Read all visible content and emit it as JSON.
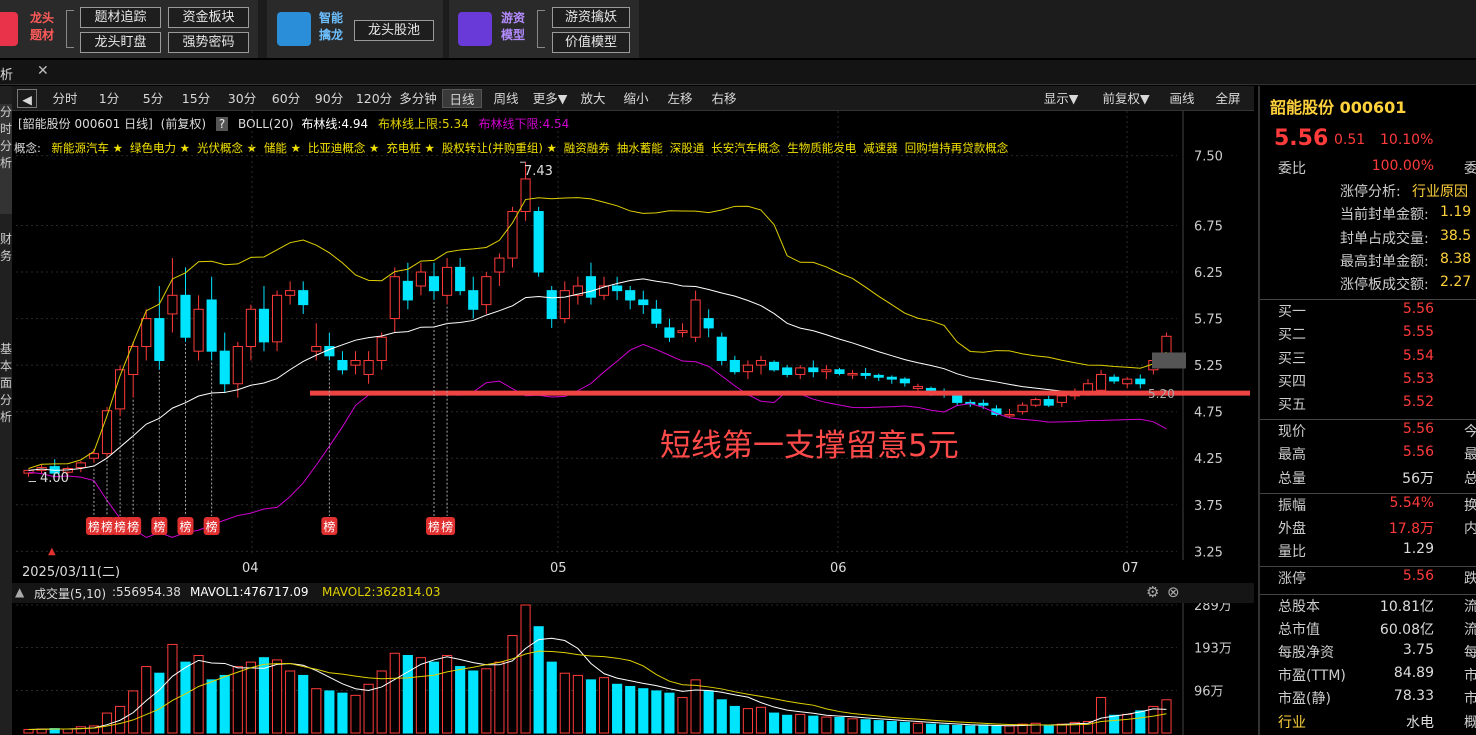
{
  "toolbar": {
    "group1": {
      "title_line1": "龙头",
      "title_line2": "题材",
      "buttons": [
        "题材追踪",
        "资金板块",
        "龙头盯盘",
        "强势密码"
      ]
    },
    "group2": {
      "title_line1": "智能",
      "title_line2": "擒龙",
      "buttons": [
        "龙头股池"
      ]
    },
    "group3": {
      "title_line1": "游资",
      "title_line2": "模型",
      "buttons": [
        "游资擒妖",
        "价值模型"
      ]
    }
  },
  "tab": {
    "label": "析",
    "close": "✕"
  },
  "side_tabs": [
    "分时分析",
    "财务",
    "基本面分析"
  ],
  "periods": [
    "分时",
    "1分",
    "5分",
    "15分",
    "30分",
    "60分",
    "90分",
    "120分",
    "多分钟",
    "日线",
    "周线",
    "更多▼",
    "放大",
    "缩小",
    "左移",
    "右移"
  ],
  "active_period": "日线",
  "right_buttons": [
    "显示▼",
    "前复权▼",
    "画线",
    "全屏"
  ],
  "chart_header": {
    "stock": "[韶能股份 000601 日线]",
    "adjust": "(前复权)",
    "help": "?",
    "boll": "BOLL(20)",
    "mid": "布林线:4.94",
    "upper": "布林线上限:5.34",
    "lower": "布林线下限:4.54"
  },
  "concepts": {
    "label": "概念:",
    "items": [
      "新能源汽车 ★",
      "绿色电力 ★",
      "光伏概念 ★",
      "储能 ★",
      "比亚迪概念 ★",
      "充电桩 ★",
      "股权转让(并购重组) ★",
      "融资融券",
      "抽水蓄能",
      "深股通",
      "长安汽车概念",
      "生物质能发电",
      "减速器",
      "回购增持再贷款概念"
    ]
  },
  "annotation": "短线第一支撑留意5元",
  "price_labels": {
    "high": "7.43",
    "low": "4.00",
    "last": "5.20"
  },
  "bang_label": "榜",
  "dates": [
    "2025/03/11(二)",
    "04",
    "05",
    "06",
    "07"
  ],
  "volume_header": {
    "title": "成交量(5,10)",
    "vol": ":556954.38",
    "mavol1": "MAVOL1:476717.09",
    "mavol2": "MAVOL2:362814.03"
  },
  "colors": {
    "up": "#ff3b3b",
    "down": "#00e5ff",
    "upper": "#e0d000",
    "mid": "#ffffff",
    "lower": "#d000d0",
    "support": "#ee4444"
  },
  "chart_data": {
    "type": "candlestick",
    "y_axis_ticks": [
      "7.50",
      "6.75",
      "6.25",
      "5.75",
      "5.25",
      "4.75",
      "4.25",
      "3.75",
      "3.25"
    ],
    "ylim": [
      3.2,
      7.55
    ],
    "support_level": 4.95,
    "candles": [
      [
        4.09,
        4.13,
        4.05,
        4.12
      ],
      [
        4.12,
        4.18,
        4.08,
        4.15
      ],
      [
        4.16,
        4.24,
        4.05,
        4.09
      ],
      [
        4.1,
        4.16,
        4.06,
        4.14
      ],
      [
        4.15,
        4.22,
        4.1,
        4.2
      ],
      [
        4.25,
        4.35,
        4.2,
        4.3
      ],
      [
        4.3,
        4.8,
        4.25,
        4.76
      ],
      [
        4.78,
        5.25,
        4.7,
        5.2
      ],
      [
        5.15,
        5.5,
        4.9,
        5.45
      ],
      [
        5.45,
        5.85,
        5.3,
        5.75
      ],
      [
        5.75,
        6.1,
        5.2,
        5.3
      ],
      [
        5.8,
        6.4,
        5.6,
        6.0
      ],
      [
        6.0,
        6.3,
        5.5,
        5.55
      ],
      [
        5.4,
        6.0,
        5.3,
        5.85
      ],
      [
        5.95,
        6.2,
        5.3,
        5.4
      ],
      [
        5.4,
        5.6,
        4.95,
        5.05
      ],
      [
        5.05,
        5.5,
        4.9,
        5.45
      ],
      [
        5.45,
        5.9,
        5.3,
        5.85
      ],
      [
        5.85,
        6.1,
        5.4,
        5.5
      ],
      [
        5.5,
        6.05,
        5.4,
        6.0
      ],
      [
        6.0,
        6.15,
        5.9,
        6.05
      ],
      [
        6.05,
        6.15,
        5.8,
        5.9
      ],
      [
        5.4,
        5.7,
        5.3,
        5.45
      ],
      [
        5.45,
        5.6,
        5.3,
        5.35
      ],
      [
        5.3,
        5.4,
        5.15,
        5.2
      ],
      [
        5.25,
        5.4,
        5.15,
        5.3
      ],
      [
        5.15,
        5.4,
        5.05,
        5.3
      ],
      [
        5.3,
        5.6,
        5.2,
        5.55
      ],
      [
        5.75,
        6.3,
        5.6,
        6.2
      ],
      [
        6.15,
        6.35,
        5.85,
        5.95
      ],
      [
        6.1,
        6.35,
        6.0,
        6.25
      ],
      [
        6.2,
        6.35,
        5.95,
        6.05
      ],
      [
        6.0,
        6.4,
        5.9,
        6.3
      ],
      [
        6.3,
        6.4,
        6.0,
        6.05
      ],
      [
        6.05,
        6.2,
        5.75,
        5.85
      ],
      [
        5.9,
        6.25,
        5.8,
        6.2
      ],
      [
        6.25,
        6.45,
        6.1,
        6.4
      ],
      [
        6.4,
        6.95,
        6.3,
        6.9
      ],
      [
        6.9,
        7.43,
        6.8,
        7.25
      ],
      [
        6.9,
        6.95,
        6.2,
        6.25
      ],
      [
        6.05,
        6.1,
        5.65,
        5.75
      ],
      [
        5.75,
        6.15,
        5.7,
        6.05
      ],
      [
        6.0,
        6.2,
        5.9,
        6.1
      ],
      [
        6.2,
        6.35,
        5.9,
        5.98
      ],
      [
        6.0,
        6.2,
        5.95,
        6.1
      ],
      [
        6.1,
        6.2,
        5.95,
        6.05
      ],
      [
        6.05,
        6.1,
        5.85,
        5.95
      ],
      [
        5.95,
        6.05,
        5.8,
        5.9
      ],
      [
        5.85,
        5.95,
        5.65,
        5.7
      ],
      [
        5.65,
        5.75,
        5.5,
        5.55
      ],
      [
        5.6,
        5.7,
        5.55,
        5.62
      ],
      [
        5.55,
        6.05,
        5.5,
        5.95
      ],
      [
        5.75,
        5.85,
        5.55,
        5.65
      ],
      [
        5.55,
        5.6,
        5.25,
        5.3
      ],
      [
        5.3,
        5.35,
        5.15,
        5.18
      ],
      [
        5.18,
        5.3,
        5.1,
        5.25
      ],
      [
        5.25,
        5.35,
        5.15,
        5.3
      ],
      [
        5.28,
        5.3,
        5.18,
        5.2
      ],
      [
        5.22,
        5.25,
        5.12,
        5.15
      ],
      [
        5.15,
        5.25,
        5.1,
        5.22
      ],
      [
        5.22,
        5.3,
        5.12,
        5.18
      ],
      [
        5.18,
        5.25,
        5.1,
        5.2
      ],
      [
        5.2,
        5.22,
        5.14,
        5.16
      ],
      [
        5.16,
        5.2,
        5.1,
        5.16
      ],
      [
        5.16,
        5.22,
        5.1,
        5.14
      ],
      [
        5.14,
        5.16,
        5.08,
        5.12
      ],
      [
        5.12,
        5.14,
        5.05,
        5.1
      ],
      [
        5.1,
        5.12,
        5.02,
        5.06
      ],
      [
        5.0,
        5.05,
        4.95,
        5.02
      ],
      [
        5.0,
        5.02,
        4.92,
        4.96
      ],
      [
        4.96,
        5.0,
        4.9,
        4.94
      ],
      [
        4.92,
        4.95,
        4.82,
        4.85
      ],
      [
        4.85,
        4.88,
        4.8,
        4.84
      ],
      [
        4.84,
        4.88,
        4.78,
        4.82
      ],
      [
        4.78,
        4.82,
        4.7,
        4.72
      ],
      [
        4.72,
        4.78,
        4.68,
        4.72
      ],
      [
        4.75,
        4.85,
        4.72,
        4.82
      ],
      [
        4.82,
        4.9,
        4.8,
        4.88
      ],
      [
        4.88,
        4.92,
        4.8,
        4.82
      ],
      [
        4.85,
        4.95,
        4.8,
        4.92
      ],
      [
        4.92,
        5.0,
        4.88,
        4.95
      ],
      [
        4.95,
        5.1,
        4.92,
        5.05
      ],
      [
        4.98,
        5.2,
        4.95,
        5.15
      ],
      [
        5.12,
        5.15,
        5.05,
        5.08
      ],
      [
        5.05,
        5.12,
        5.0,
        5.1
      ],
      [
        5.1,
        5.15,
        5.0,
        5.05
      ],
      [
        5.2,
        5.35,
        5.15,
        5.3
      ],
      [
        5.3,
        5.6,
        5.3,
        5.56
      ]
    ],
    "bang_index": [
      5,
      6,
      7,
      8,
      10,
      12,
      14,
      23,
      31,
      32
    ],
    "volume_ticks": [
      "289万",
      "193万",
      "96万"
    ],
    "volume_max": 289,
    "volumes": [
      8,
      9,
      10,
      9,
      14,
      16,
      45,
      60,
      95,
      150,
      135,
      200,
      160,
      175,
      120,
      130,
      150,
      160,
      170,
      165,
      140,
      130,
      100,
      95,
      90,
      85,
      110,
      140,
      180,
      175,
      170,
      160,
      175,
      150,
      140,
      145,
      160,
      220,
      289,
      240,
      160,
      135,
      130,
      120,
      125,
      110,
      105,
      100,
      95,
      90,
      80,
      120,
      95,
      75,
      60,
      55,
      58,
      45,
      40,
      42,
      38,
      36,
      35,
      32,
      30,
      28,
      26,
      24,
      22,
      20,
      18,
      17,
      16,
      18,
      15,
      16,
      20,
      22,
      18,
      20,
      24,
      26,
      80,
      40,
      42,
      50,
      60,
      75
    ]
  }
}
